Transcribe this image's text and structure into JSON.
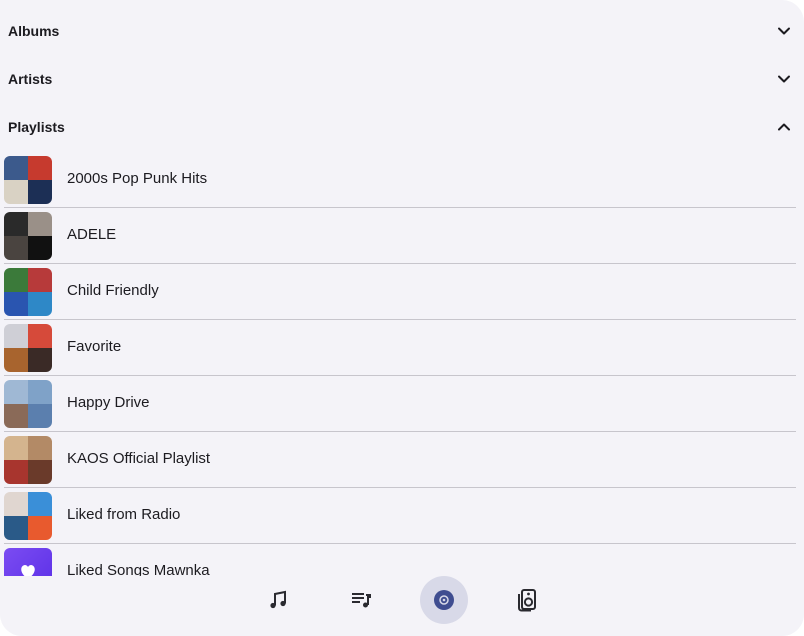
{
  "sections": [
    {
      "title": "Albums",
      "expanded": false,
      "chevron": "chevron-down-icon"
    },
    {
      "title": "Artists",
      "expanded": false,
      "chevron": "chevron-down-icon"
    },
    {
      "title": "Playlists",
      "expanded": true,
      "chevron": "chevron-up-icon"
    }
  ],
  "playlists": [
    {
      "name": "2000s Pop Punk Hits",
      "art": [
        "#3c5a8c",
        "#c63a2e",
        "#d9d2c4",
        "#1c2f55"
      ]
    },
    {
      "name": "ADELE",
      "art": [
        "#2a2a2a",
        "#9a9088",
        "#4a4440",
        "#111111"
      ]
    },
    {
      "name": "Child Friendly",
      "art": [
        "#3b7a3a",
        "#b73a3a",
        "#2a55b0",
        "#2e88c7"
      ]
    },
    {
      "name": "Favorite",
      "art": [
        "#cfcfd6",
        "#d64a3a",
        "#a8642e",
        "#3a2a26"
      ]
    },
    {
      "name": "Happy Drive",
      "art": [
        "#9fb8d4",
        "#7fa2c8",
        "#8a6a58",
        "#5b7fae"
      ]
    },
    {
      "name": "KAOS Official Playlist",
      "art": [
        "#d4b48e",
        "#b38a66",
        "#a8352e",
        "#6a3a2a"
      ]
    },
    {
      "name": "Liked from Radio",
      "art": [
        "#e0d6d0",
        "#3a8fd8",
        "#2a5a88",
        "#e85a2e"
      ]
    },
    {
      "name": "Liked Songs Mawnka",
      "art": [
        "#6a3df0",
        "#7b4cf2",
        "#5a2ee6",
        "#6a3df0"
      ]
    }
  ],
  "nav": [
    {
      "name": "songs",
      "icon": "music-note-icon",
      "active": false
    },
    {
      "name": "queue",
      "icon": "queue-music-icon",
      "active": false
    },
    {
      "name": "library",
      "icon": "album-icon",
      "active": true
    },
    {
      "name": "speakers",
      "icon": "speaker-icon",
      "active": false
    }
  ],
  "colors": {
    "background": "#f4f3f8",
    "active_indicator": "#d8d9e8",
    "accent": "#3f4d90",
    "divider": "#c7c5cc",
    "text": "#1c1b20"
  }
}
